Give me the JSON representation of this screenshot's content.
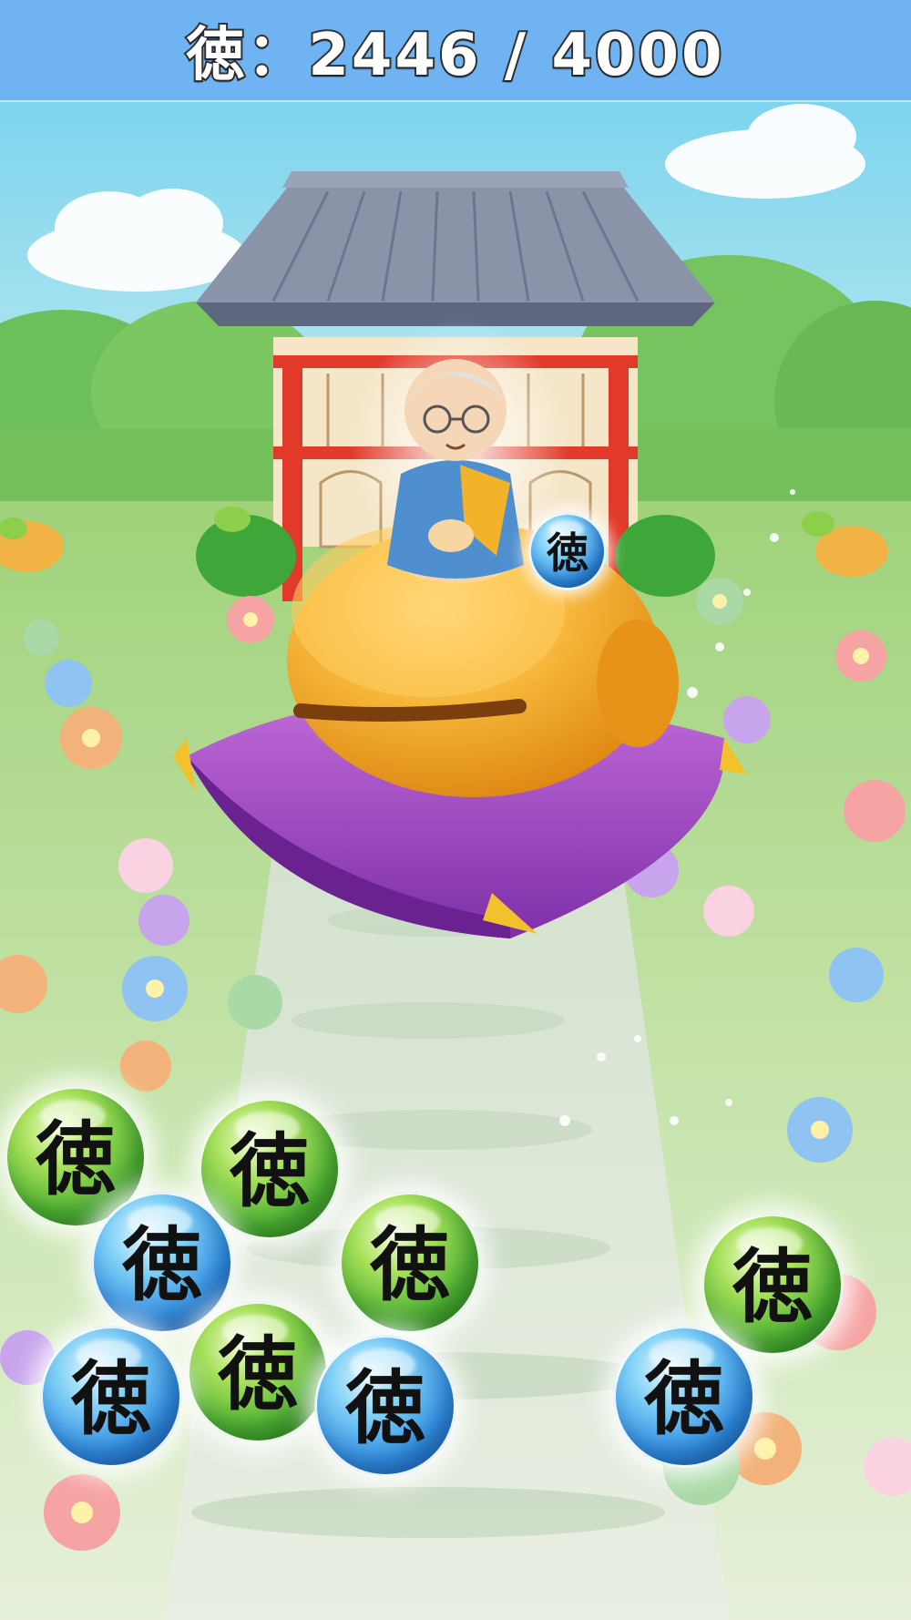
{
  "hud": {
    "score_label": "徳：2446 / 4000"
  },
  "orb_glyph": "徳",
  "colors": {
    "header": "#6fb3f2",
    "orb_green": "#4caf32",
    "orb_blue": "#2f8be0",
    "cushion": "#9b3ac0",
    "bell": "#f2a21e"
  }
}
